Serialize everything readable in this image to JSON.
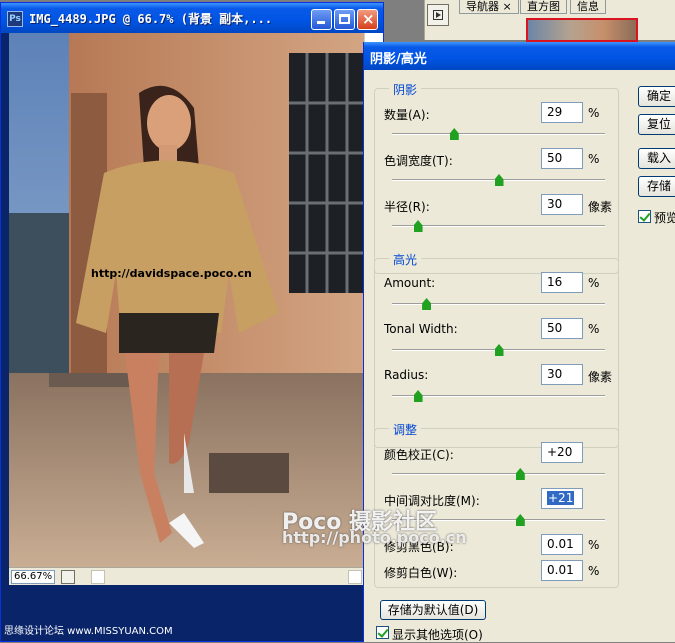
{
  "document": {
    "title": "IMG_4489.JPG @ 66.7% (背景 副本,...",
    "zoom": "66.67%",
    "image_overlay_text": "http://davidspace.poco.cn",
    "icon": "photoshop-app-icon"
  },
  "navigator_palette": {
    "tabs": [
      "导航器",
      "直方图",
      "信息"
    ],
    "close_glyph": "×"
  },
  "dialog": {
    "title": "阴影/高光",
    "shadows": {
      "title": "阴影",
      "amount_label": "数量(A):",
      "amount_value": "29",
      "amount_unit": "%",
      "amount_pct": 29,
      "tonal_width_label": "色调宽度(T):",
      "tonal_width_value": "50",
      "tonal_width_unit": "%",
      "tonal_width_pct": 50,
      "radius_label": "半径(R):",
      "radius_value": "30",
      "radius_unit": "像素",
      "radius_pct": 12
    },
    "highlights": {
      "title": "高光",
      "amount_label": "Amount:",
      "amount_value": "16",
      "amount_unit": "%",
      "amount_pct": 16,
      "tonal_width_label": "Tonal Width:",
      "tonal_width_value": "50",
      "tonal_width_unit": "%",
      "tonal_width_pct": 50,
      "radius_label": "Radius:",
      "radius_value": "30",
      "radius_unit": "像素",
      "radius_pct": 12
    },
    "adjustments": {
      "title": "调整",
      "color_correction_label": "颜色校正(C):",
      "color_correction_value": "+20",
      "color_correction_pct": 60,
      "midtone_contrast_label": "中间调对比度(M):",
      "midtone_contrast_value": "+21",
      "midtone_contrast_pct": 60,
      "clip_black_label": "修剪黑色(B):",
      "clip_black_value": "0.01",
      "clip_black_unit": "%",
      "clip_white_label": "修剪白色(W):",
      "clip_white_value": "0.01",
      "clip_white_unit": "%"
    },
    "buttons": {
      "ok": "确定",
      "cancel": "复位",
      "load": "载入",
      "save": "存储",
      "preview": "预览"
    },
    "save_defaults": "存储为默认值(D)",
    "show_more": "显示其他选项(O)"
  },
  "watermark": {
    "line1": "Poco 摄影社区",
    "line2": "http://photo.poco.cn"
  },
  "footer_credit": "思缘设计论坛 www.MISSYUAN.COM"
}
